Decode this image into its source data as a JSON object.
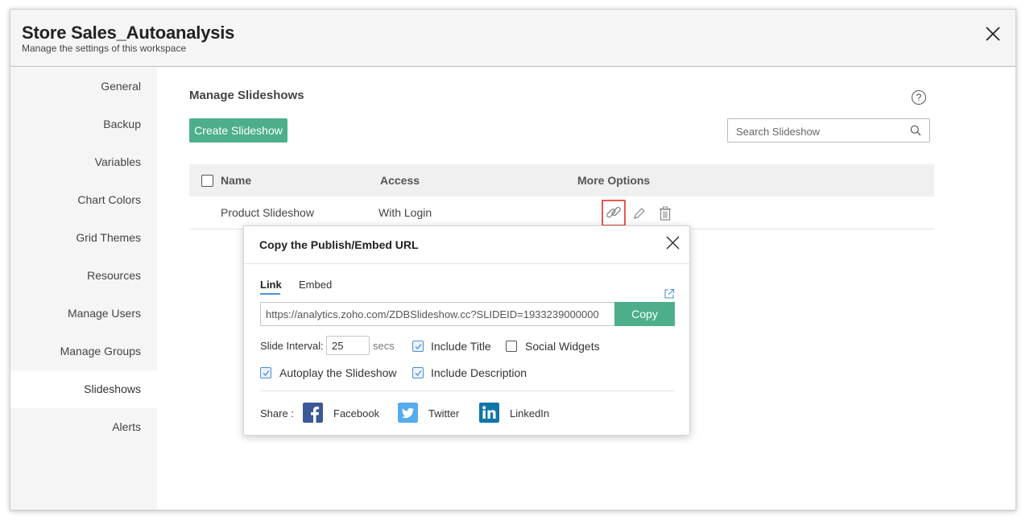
{
  "header": {
    "title": "Store Sales_Autoanalysis",
    "subtitle": "Manage the settings of this workspace"
  },
  "sidebar": {
    "items": [
      {
        "label": "General"
      },
      {
        "label": "Backup"
      },
      {
        "label": "Variables"
      },
      {
        "label": "Chart Colors"
      },
      {
        "label": "Grid Themes"
      },
      {
        "label": "Resources"
      },
      {
        "label": "Manage Users"
      },
      {
        "label": "Manage Groups"
      },
      {
        "label": "Slideshows",
        "active": true
      },
      {
        "label": "Alerts"
      }
    ]
  },
  "main": {
    "title": "Manage Slideshows",
    "help_label": "?",
    "create_label": "Create Slideshow",
    "search_placeholder": "Search Slideshow",
    "columns": {
      "name": "Name",
      "access": "Access",
      "more": "More Options"
    },
    "rows": [
      {
        "name": "Product Slideshow",
        "access": "With Login"
      }
    ]
  },
  "dialog": {
    "title": "Copy the Publish/Embed URL",
    "tabs": {
      "link": "Link",
      "embed": "Embed"
    },
    "url_value": "https://analytics.zoho.com/ZDBSlideshow.cc?SLIDEID=1933239000000",
    "copy_label": "Copy",
    "interval_label": "Slide Interval:",
    "interval_value": "25",
    "interval_unit": "secs",
    "options": {
      "include_title": {
        "label": "Include Title",
        "checked": true
      },
      "social_widgets": {
        "label": "Social Widgets",
        "checked": false
      },
      "autoplay": {
        "label": "Autoplay the Slideshow",
        "checked": true
      },
      "include_description": {
        "label": "Include Description",
        "checked": true
      }
    },
    "share_label": "Share :",
    "share": {
      "facebook": "Facebook",
      "twitter": "Twitter",
      "linkedin": "LinkedIn"
    }
  },
  "colors": {
    "accent_green": "#4caf89",
    "highlight_red": "#e45a51",
    "facebook": "#3b5998",
    "twitter": "#55acee",
    "linkedin": "#0e76a8"
  }
}
